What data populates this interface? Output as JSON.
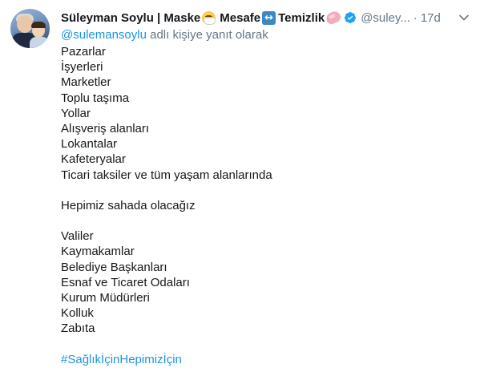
{
  "tweet": {
    "display_name": "Süleyman Soylu | Maske",
    "name_part2": "Mesafe",
    "name_part3": "Temizlik",
    "emojis": [
      "mask-face-icon",
      "left-right-arrow-icon",
      "soap-icon"
    ],
    "handle": "@suley...",
    "separator": "·",
    "time": "17d",
    "reply_mention": "@sulemansoylu",
    "reply_suffix": " adlı kişiye yanıt olarak",
    "lines_group1": [
      "Pazarlar",
      "İşyerleri",
      "Marketler",
      "Toplu taşıma",
      "Yollar",
      "Alışveriş alanları",
      "Lokantalar",
      "Kafeteryalar",
      "Ticari taksiler ve tüm yaşam alanlarında"
    ],
    "line_statement": "Hepimiz sahada olacağız",
    "lines_group2": [
      "Valiler",
      "Kaymakamlar",
      "Belediye Başkanları",
      "Esnaf ve Ticaret Odaları",
      "Kurum Müdürleri",
      "Kolluk",
      "Zabıta"
    ],
    "hashtag": "#SağlıkİçinHepimizİçin"
  },
  "colors": {
    "text": "#14171a",
    "secondary": "#657786",
    "link": "#1b95e0",
    "verified": "#1da1f2"
  }
}
